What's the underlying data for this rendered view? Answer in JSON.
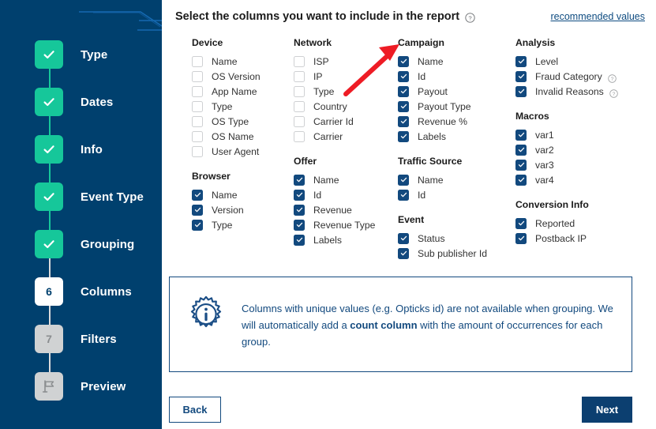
{
  "sidebar": {
    "steps": [
      {
        "label": "Type",
        "state": "done",
        "badge": "check"
      },
      {
        "label": "Dates",
        "state": "done",
        "badge": "check"
      },
      {
        "label": "Info",
        "state": "done",
        "badge": "check"
      },
      {
        "label": "Event Type",
        "state": "done",
        "badge": "check"
      },
      {
        "label": "Grouping",
        "state": "done",
        "badge": "check"
      },
      {
        "label": "Columns",
        "state": "current",
        "badge": "6"
      },
      {
        "label": "Filters",
        "state": "todo",
        "badge": "7"
      },
      {
        "label": "Preview",
        "state": "todo",
        "badge": "flag"
      }
    ],
    "colors": {
      "background": "#00406e",
      "done": "#16c79a",
      "current": "#ffffff",
      "todo": "#d0d2d3"
    }
  },
  "header": {
    "title": "Select the columns you want to include in the report",
    "help_icon": "question-circle-icon",
    "recommended_link": "recommended values"
  },
  "columns": [
    {
      "groups": [
        {
          "title": "Device",
          "items": [
            {
              "label": "Name",
              "checked": false
            },
            {
              "label": "OS Version",
              "checked": false
            },
            {
              "label": "App Name",
              "checked": false
            },
            {
              "label": "Type",
              "checked": false
            },
            {
              "label": "OS Type",
              "checked": false
            },
            {
              "label": "OS Name",
              "checked": false
            },
            {
              "label": "User Agent",
              "checked": false
            }
          ]
        },
        {
          "title": "Browser",
          "items": [
            {
              "label": "Name",
              "checked": true
            },
            {
              "label": "Version",
              "checked": true
            },
            {
              "label": "Type",
              "checked": true
            }
          ]
        }
      ]
    },
    {
      "groups": [
        {
          "title": "Network",
          "items": [
            {
              "label": "ISP",
              "checked": false
            },
            {
              "label": "IP",
              "checked": false
            },
            {
              "label": "Type",
              "checked": false
            },
            {
              "label": "Country",
              "checked": false
            },
            {
              "label": "Carrier Id",
              "checked": false
            },
            {
              "label": "Carrier",
              "checked": false
            }
          ]
        },
        {
          "title": "Offer",
          "items": [
            {
              "label": "Name",
              "checked": true
            },
            {
              "label": "Id",
              "checked": true
            },
            {
              "label": "Revenue",
              "checked": true
            },
            {
              "label": "Revenue Type",
              "checked": true
            },
            {
              "label": "Labels",
              "checked": true
            }
          ]
        }
      ]
    },
    {
      "groups": [
        {
          "title": "Campaign",
          "items": [
            {
              "label": "Name",
              "checked": true
            },
            {
              "label": "Id",
              "checked": true
            },
            {
              "label": "Payout",
              "checked": true
            },
            {
              "label": "Payout Type",
              "checked": true
            },
            {
              "label": "Revenue %",
              "checked": true
            },
            {
              "label": "Labels",
              "checked": true
            }
          ]
        },
        {
          "title": "Traffic Source",
          "items": [
            {
              "label": "Name",
              "checked": true
            },
            {
              "label": "Id",
              "checked": true
            }
          ]
        },
        {
          "title": "Event",
          "items": [
            {
              "label": "Status",
              "checked": true
            },
            {
              "label": "Sub publisher Id",
              "checked": true
            }
          ]
        }
      ]
    },
    {
      "groups": [
        {
          "title": "Analysis",
          "items": [
            {
              "label": "Level",
              "checked": true
            },
            {
              "label": "Fraud Category",
              "checked": true,
              "help": "question-circle-icon"
            },
            {
              "label": "Invalid Reasons",
              "checked": true,
              "help": "question-circle-icon"
            }
          ]
        },
        {
          "title": "Macros",
          "items": [
            {
              "label": "var1",
              "checked": true
            },
            {
              "label": "var2",
              "checked": true
            },
            {
              "label": "var3",
              "checked": true
            },
            {
              "label": "var4",
              "checked": true
            }
          ]
        },
        {
          "title": "Conversion Info",
          "items": [
            {
              "label": "Reported",
              "checked": true
            },
            {
              "label": "Postback IP",
              "checked": true
            }
          ]
        }
      ]
    }
  ],
  "infobox": {
    "icon": "gear-info-icon",
    "text_part_1": "Columns with unique values (e.g. Opticks id) are not available when grouping. We will automatically add a ",
    "text_bold": "count column",
    "text_part_2": " with the amount of occurrences for each group.",
    "border_color": "#12497e"
  },
  "footer": {
    "back_label": "Back",
    "next_label": "Next",
    "next_color": "#0c3f70"
  },
  "annotation": {
    "arrow_color": "#ee1c25",
    "points_at": "Campaign"
  }
}
